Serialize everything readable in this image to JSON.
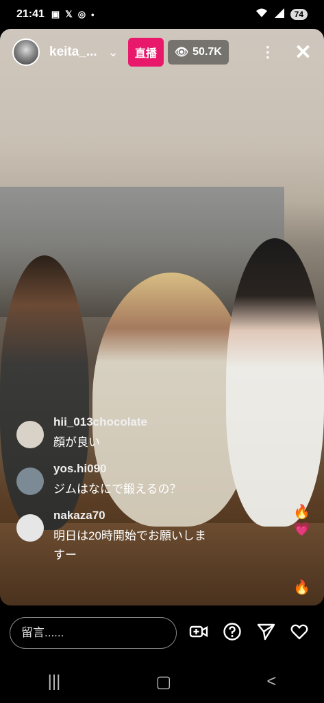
{
  "status_bar": {
    "time": "21:41",
    "left_icons": [
      "screenshot-icon",
      "x-icon",
      "instagram-icon",
      "dot-icon"
    ],
    "battery": "74"
  },
  "header": {
    "username": "keita_...",
    "live_label": "直播",
    "viewer_count": "50.7K"
  },
  "comments": [
    {
      "user": "hii_013chocolate",
      "text": "顔が良い",
      "avatar_color": "#d8d2c8"
    },
    {
      "user": "yos.hi090",
      "text": "ジムはなにで鍛えるの？",
      "avatar_color": "#7b8a94"
    },
    {
      "user": "nakaza70",
      "text": "明日は20時開始でお願いしま\nすー",
      "avatar_color": "#e6e6e6"
    }
  ],
  "reactions": [
    "🔥",
    "💗",
    "🔥"
  ],
  "bottom": {
    "input_placeholder": "留言......",
    "actions": [
      "add-video-icon",
      "question-icon",
      "send-icon",
      "heart-icon"
    ]
  },
  "nav": [
    "recent-apps-icon",
    "home-icon",
    "back-icon"
  ],
  "colors": {
    "live": "#e8196b",
    "background": "#000000"
  }
}
